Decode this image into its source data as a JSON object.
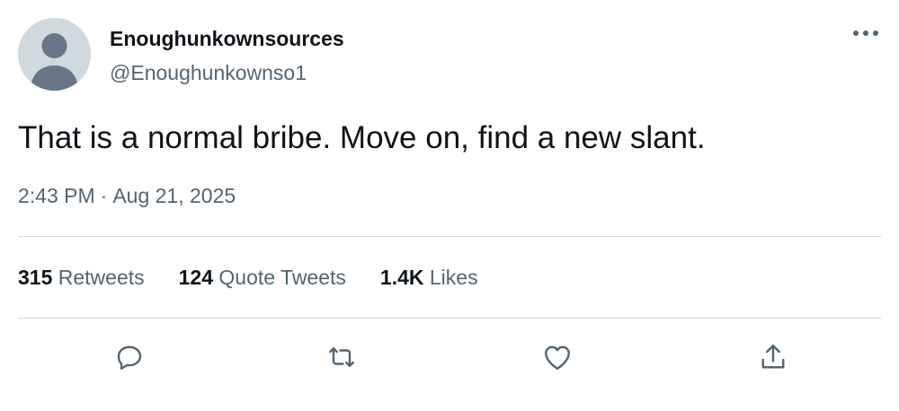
{
  "author": {
    "display_name": "Enoughunkownsources",
    "handle": "@Enoughunkownso1",
    "avatar_icon": "default-avatar-icon"
  },
  "tweet": {
    "text": "That is a normal bribe. Move on, find a new slant.",
    "time": "2:43 PM",
    "separator": "·",
    "date": "Aug 21, 2025"
  },
  "stats": [
    {
      "count": "315",
      "label": "Retweets"
    },
    {
      "count": "124",
      "label": "Quote Tweets"
    },
    {
      "count": "1.4K",
      "label": "Likes"
    }
  ],
  "actions": [
    {
      "icon": "reply-icon"
    },
    {
      "icon": "retweet-icon"
    },
    {
      "icon": "like-icon"
    },
    {
      "icon": "share-icon"
    }
  ],
  "menu_icon": "more-options-icon",
  "colors": {
    "text_primary": "#0f1419",
    "text_secondary": "#536471",
    "divider": "#cfd9de",
    "avatar_bg": "#cfd9de",
    "avatar_fg": "#687785"
  }
}
